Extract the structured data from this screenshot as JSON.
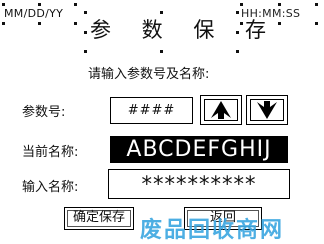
{
  "header": {
    "date": "MM/DD/YY",
    "time": "HH:MM:SS",
    "title": "参 数 保 存"
  },
  "prompt": "请输入参数号及名称:",
  "param": {
    "label": "参数号:",
    "value": "####",
    "up_icon": "arrow-up-icon",
    "down_icon": "arrow-down-icon"
  },
  "current_name": {
    "label": "当前名称:",
    "value": "ABCDEFGHIJ"
  },
  "input_name": {
    "label": "输入名称:",
    "value": "**********"
  },
  "buttons": {
    "confirm_save": "确定保存",
    "back": "返回"
  },
  "watermark": "废品回收商网",
  "colors": {
    "watermark": "#3aa6e0"
  }
}
